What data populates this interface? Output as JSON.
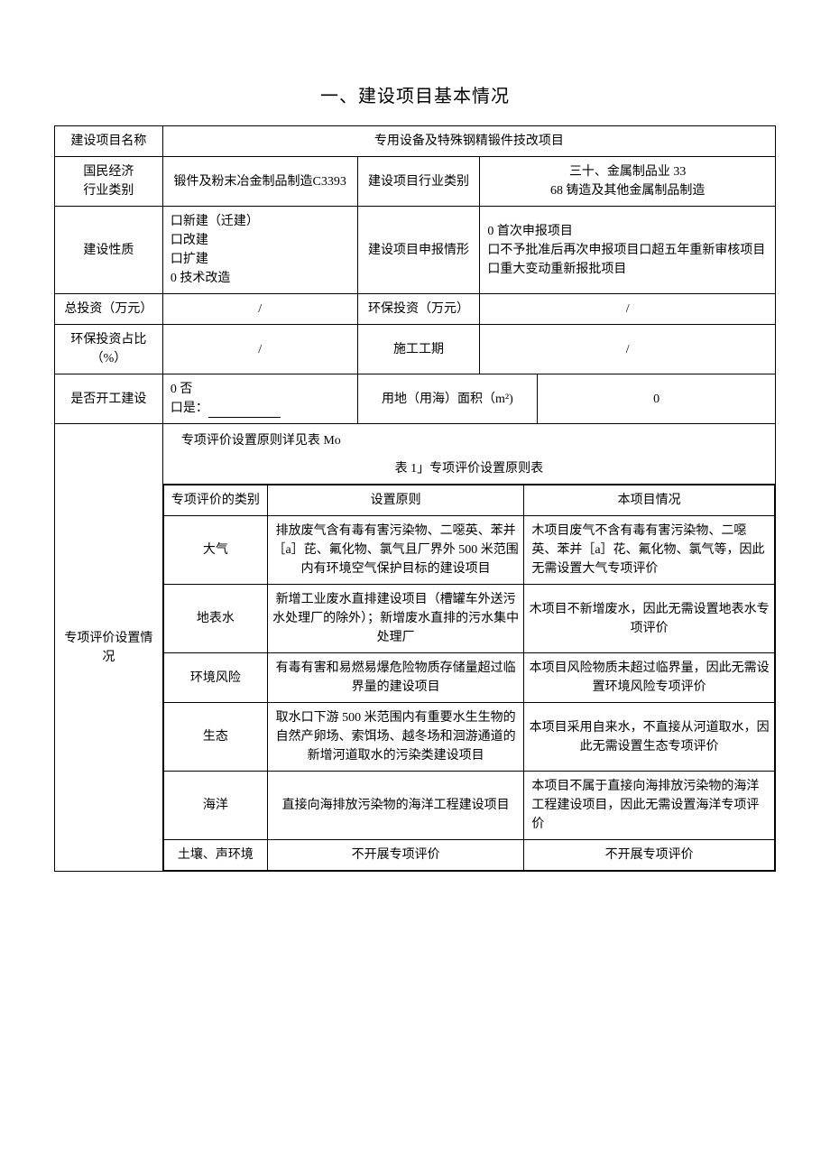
{
  "title": "一、建设项目基本情况",
  "rows": {
    "projectNameLabel": "建设项目名称",
    "projectNameValue": "专用设备及特殊钢精锻件技改项目",
    "econCategoryLabel": "国民经济\n行业类别",
    "econCategoryValue": "锻件及粉末冶金制品制造C3393",
    "projIndustryLabel": "建设项目行业类别",
    "projIndustryValue": "三十、金属制品业 33\n68 铸造及其他金属制品制造",
    "buildNatureLabel": "建设性质",
    "buildNatureValue": "口新建（迁建）\n口改建\n口扩建\n0 技术改造",
    "applyTypeLabel": "建设项目申报情形",
    "applyTypeValue": "0 首次申报项目\n口不予批准后再次申报项目口超五年重新审核项目口重大变动重新报批项目",
    "totalInvestLabel": "总投资（万元）",
    "totalInvestValue": "/",
    "envInvestLabel": "环保投资（万元）",
    "envInvestValue": "/",
    "envRatioLabel": "环保投资占比（%）",
    "envRatioValue": "/",
    "constructPeriodLabel": "施工工期",
    "constructPeriodValue": "/",
    "startedLabel": "是否开工建设",
    "startedValueNo": "0 否",
    "startedValueYes": "口是：",
    "landAreaLabel": "用地（用海）面积（m²)",
    "landAreaValue": "0",
    "specialEvalLabel": "专项评价设置情况",
    "subHeading": "专项评价设置原则详见表 Mo",
    "subTableTitle": "表 1」专项评价设置原则表",
    "subHeaders": {
      "col1": "专项评价的类别",
      "col2": "设置原则",
      "col3": "本项目情况"
    },
    "subRows": [
      {
        "cat": "大气",
        "principle": "排放废气含有毒有害污染物、二噁英、苯并［a］芘、氟化物、氯气且厂界外 500 米范围内有环境空气保护目标的建设项目",
        "situation": "木项目废气不含有毒有害污染物、二噁英、苯并［a］花、氟化物、氯气等，因此无需设置大气专项评价"
      },
      {
        "cat": "地表水",
        "principle": "新增工业废水直排建设项目（槽罐车外送污水处理厂的除外）；新增废水直排的污水集中处理厂",
        "situation": "木项目不新增废水，因此无需设置地表水专项评价"
      },
      {
        "cat": "环境风险",
        "principle": "有毒有害和易燃易爆危险物质存储量超过临界量的建设项目",
        "situation": "本项目风险物质未超过临界量，因此无需设置环境风险专项评价"
      },
      {
        "cat": "生态",
        "principle": "取水口下游 500 米范围内有重要水生生物的自然产卵场、索饵场、越冬场和洄游通道的新增河道取水的污染类建设项目",
        "situation": "本项目采用自来水，不直接从河道取水，因此无需设置生态专项评价"
      },
      {
        "cat": "海洋",
        "principle": "直接向海排放污染物的海洋工程建设项目",
        "situation": "本项目不属于直接向海排放污染物的海洋工程建设项目，因此无需设置海洋专项评价"
      },
      {
        "cat": "土壤、声环境",
        "principle": "不开展专项评价",
        "situation": "不开展专项评价"
      }
    ]
  }
}
